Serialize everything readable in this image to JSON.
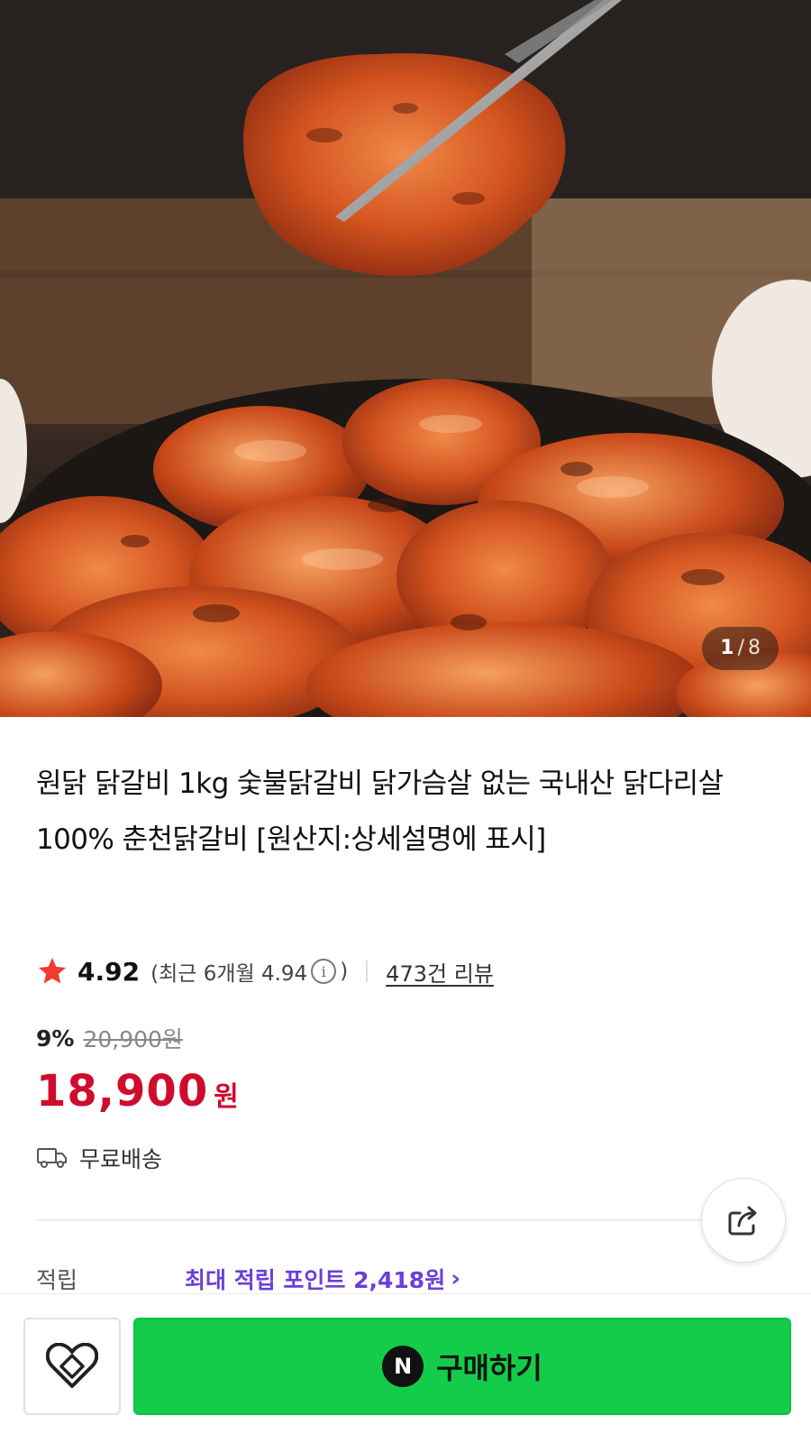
{
  "gallery": {
    "current": "1",
    "separator": "/",
    "total": "8"
  },
  "product": {
    "title": "원닭 닭갈비 1kg 숯불닭갈비 닭가슴살 없는 국내산 닭다리살 100% 춘천닭갈비 [원산지:상세설명에 표시]"
  },
  "rating": {
    "score": "4.92",
    "recent_prefix": "(최근 6개월 4.94",
    "recent_suffix": ")",
    "info_glyph": "i",
    "review_count": "473건 리뷰",
    "star_color": "#f03c2e"
  },
  "price": {
    "discount_rate": "9%",
    "original": "20,900원",
    "sale": "18,900",
    "sale_unit": "원",
    "sale_color": "#cf0c2c"
  },
  "delivery": {
    "label": "무료배송",
    "icon": "truck-icon"
  },
  "points": {
    "label": "적립",
    "value": "최대 적립 포인트 2,418원",
    "chevron": "›",
    "color": "#6b3fdb"
  },
  "actions": {
    "share_icon": "share-icon",
    "wish_icon": "heart-icon",
    "buy_logo": "N",
    "buy_label": "구매하기",
    "buy_color": "#13cd4a"
  }
}
